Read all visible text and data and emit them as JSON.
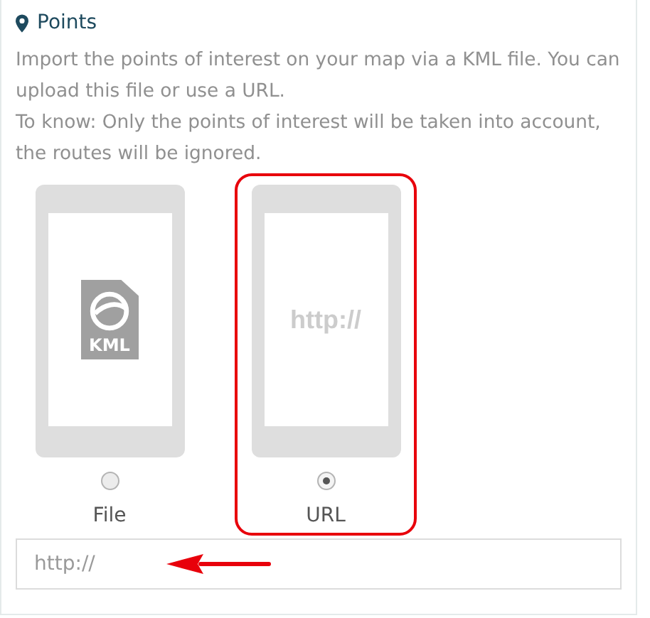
{
  "section": {
    "title": "Points"
  },
  "description": [
    "Import the points of interest on your map via a KML file. You can upload this file or use a URL.",
    "To know: Only the points of interest will be taken into account, the routes will be ignored."
  ],
  "options": [
    {
      "kind": "kml",
      "label": "File",
      "screen_text": "KML",
      "selected": false,
      "highlighted": false
    },
    {
      "kind": "url",
      "label": "URL",
      "screen_text": "http://",
      "selected": true,
      "highlighted": true
    }
  ],
  "url_field": {
    "placeholder": "http://"
  }
}
